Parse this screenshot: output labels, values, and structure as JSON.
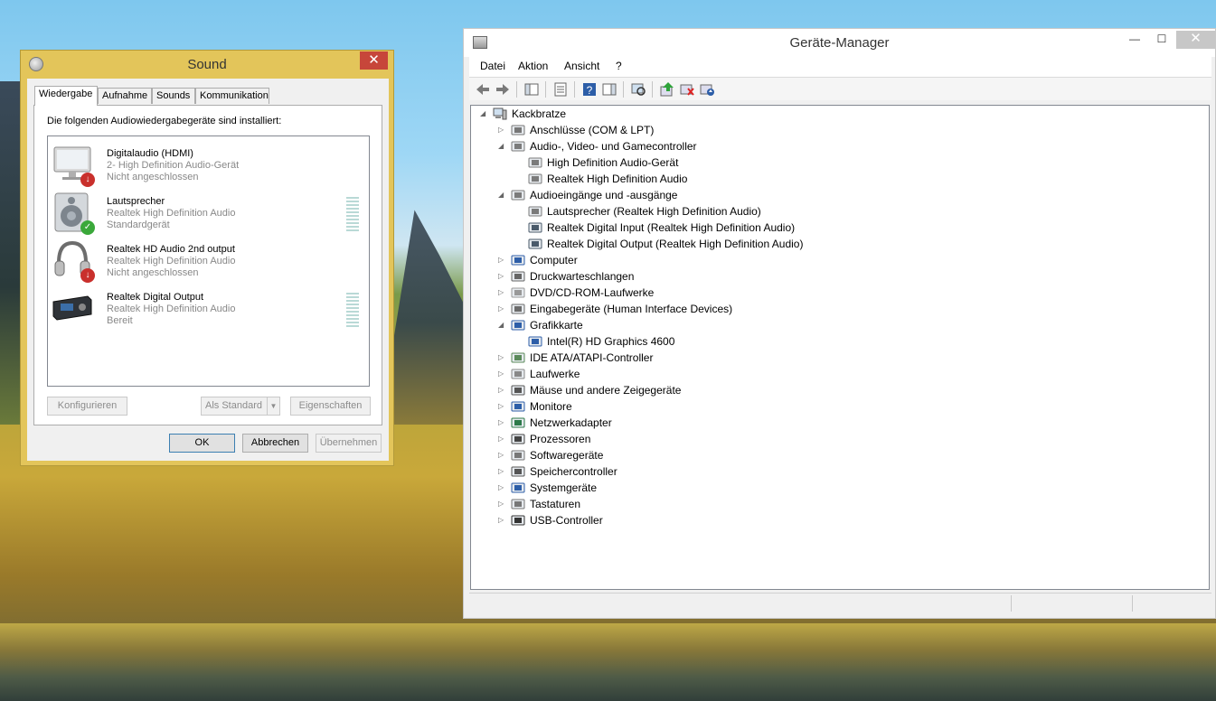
{
  "sound": {
    "title": "Sound",
    "close": "✕",
    "tabs": [
      "Wiedergabe",
      "Aufnahme",
      "Sounds",
      "Kommunikation"
    ],
    "intro": "Die folgenden Audiowiedergabegeräte sind installiert:",
    "devices": [
      {
        "name": "Digitalaudio (HDMI)",
        "driver": "2- High Definition Audio-Gerät",
        "status": "Nicht angeschlossen",
        "icon": "monitor-icon",
        "badge": "red"
      },
      {
        "name": "Lautsprecher",
        "driver": "Realtek High Definition Audio",
        "status": "Standardgerät",
        "icon": "speaker-icon",
        "badge": "green"
      },
      {
        "name": "Realtek HD Audio 2nd output",
        "driver": "Realtek High Definition Audio",
        "status": "Nicht angeschlossen",
        "icon": "headphones-icon",
        "badge": "red"
      },
      {
        "name": "Realtek Digital Output",
        "driver": "Realtek High Definition Audio",
        "status": "Bereit",
        "icon": "digital-output-icon",
        "badge": ""
      }
    ],
    "buttons": {
      "configure": "Konfigurieren",
      "set_default": "Als Standard",
      "properties": "Eigenschaften",
      "ok": "OK",
      "cancel": "Abbrechen",
      "apply": "Übernehmen"
    }
  },
  "devmgr": {
    "title": "Geräte-Manager",
    "controls": {
      "minimize": "—",
      "maximize": "☐",
      "close": "✕"
    },
    "menu": [
      "Datei",
      "Aktion",
      "Ansicht",
      "?"
    ],
    "tree": {
      "root": "Kackbratze",
      "nodes": [
        {
          "label": "Anschlüsse (COM & LPT)",
          "level": 1,
          "exp": "▷"
        },
        {
          "label": "Audio-, Video- und Gamecontroller",
          "level": 1,
          "exp": "◢"
        },
        {
          "label": "High Definition Audio-Gerät",
          "level": 2,
          "exp": ""
        },
        {
          "label": "Realtek High Definition Audio",
          "level": 2,
          "exp": ""
        },
        {
          "label": "Audioeingänge und -ausgänge",
          "level": 1,
          "exp": "◢"
        },
        {
          "label": "Lautsprecher (Realtek High Definition Audio)",
          "level": 2,
          "exp": ""
        },
        {
          "label": "Realtek Digital Input (Realtek High Definition Audio)",
          "level": 2,
          "exp": ""
        },
        {
          "label": "Realtek Digital Output (Realtek High Definition Audio)",
          "level": 2,
          "exp": ""
        },
        {
          "label": "Computer",
          "level": 1,
          "exp": "▷"
        },
        {
          "label": "Druckwarteschlangen",
          "level": 1,
          "exp": "▷"
        },
        {
          "label": "DVD/CD-ROM-Laufwerke",
          "level": 1,
          "exp": "▷"
        },
        {
          "label": "Eingabegeräte (Human Interface Devices)",
          "level": 1,
          "exp": "▷"
        },
        {
          "label": "Grafikkarte",
          "level": 1,
          "exp": "◢"
        },
        {
          "label": "Intel(R) HD Graphics 4600",
          "level": 2,
          "exp": ""
        },
        {
          "label": "IDE ATA/ATAPI-Controller",
          "level": 1,
          "exp": "▷"
        },
        {
          "label": "Laufwerke",
          "level": 1,
          "exp": "▷"
        },
        {
          "label": "Mäuse und andere Zeigegeräte",
          "level": 1,
          "exp": "▷"
        },
        {
          "label": "Monitore",
          "level": 1,
          "exp": "▷"
        },
        {
          "label": "Netzwerkadapter",
          "level": 1,
          "exp": "▷"
        },
        {
          "label": "Prozessoren",
          "level": 1,
          "exp": "▷"
        },
        {
          "label": "Softwaregeräte",
          "level": 1,
          "exp": "▷"
        },
        {
          "label": "Speichercontroller",
          "level": 1,
          "exp": "▷"
        },
        {
          "label": "Systemgeräte",
          "level": 1,
          "exp": "▷"
        },
        {
          "label": "Tastaturen",
          "level": 1,
          "exp": "▷"
        },
        {
          "label": "USB-Controller",
          "level": 1,
          "exp": "▷"
        }
      ]
    }
  }
}
